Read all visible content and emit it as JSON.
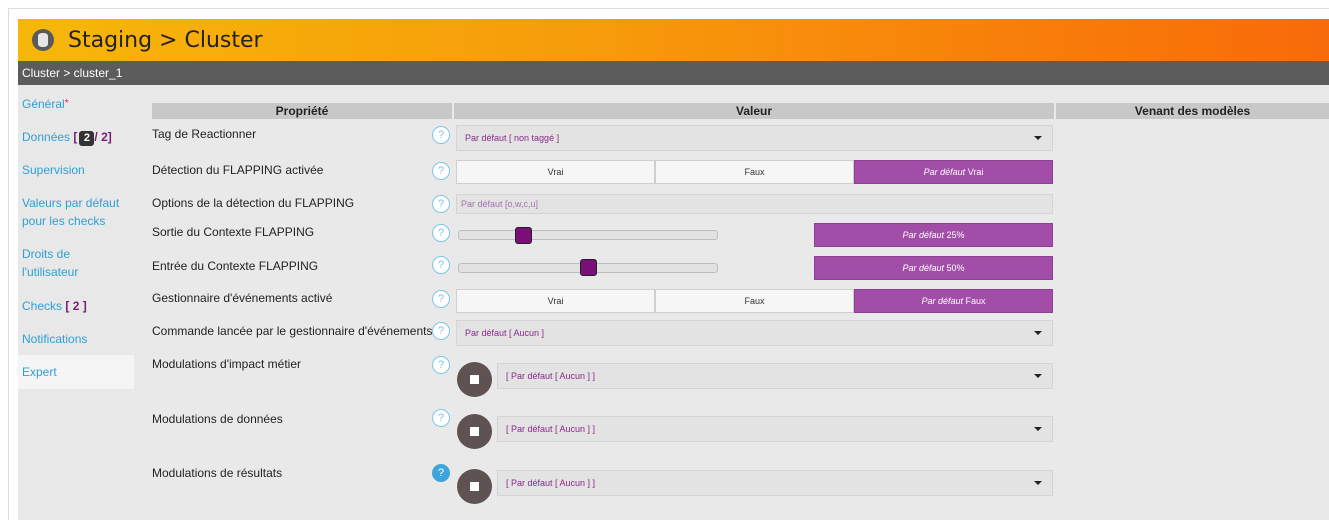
{
  "header": {
    "title": "Staging > Cluster",
    "icon": "database-icon"
  },
  "breadcrumb": "Cluster > cluster_1",
  "sidebar": {
    "general": {
      "label": "Général",
      "required_mark": "*"
    },
    "donnees": {
      "label": "Données",
      "open": "[",
      "badge": "2",
      "sep": "/",
      "count": "2",
      "close": "]"
    },
    "supervision": "Supervision",
    "valeurs": "Valeurs par défaut pour les checks",
    "droits": "Droits de l'utilisateur",
    "checks": {
      "label": "Checks",
      "count": "[ 2 ]"
    },
    "notifications": "Notifications",
    "expert": "Expert"
  },
  "table": {
    "headers": [
      "Propriété",
      "Valeur",
      "Venant des modèles"
    ]
  },
  "help_glyph": "?",
  "props": {
    "tag": {
      "label": "Tag de Reactionner",
      "value": "Par défaut [ non taggé ]"
    },
    "flapping": {
      "label": "Détection du FLAPPING activée",
      "options": [
        "Vrai",
        "Faux"
      ],
      "default_prefix": "Par défaut",
      "default_value": "Vrai"
    },
    "flap_opts": {
      "label": "Options de la détection du FLAPPING",
      "placeholder": "Par défaut [o,w,c,u]"
    },
    "sortie": {
      "label": "Sortie du Contexte FLAPPING",
      "default_prefix": "Par défaut",
      "default_value": "25%",
      "level": 0.25
    },
    "entree": {
      "label": "Entrée du Contexte FLAPPING",
      "default_prefix": "Par défaut",
      "default_value": "50%",
      "level": 0.5
    },
    "gest": {
      "label": "Gestionnaire d'événements activé",
      "options": [
        "Vrai",
        "Faux"
      ],
      "default_prefix": "Par défaut",
      "default_value": "Faux"
    },
    "commande": {
      "label": "Commande lancée par le gestionnaire d'événements",
      "value": "Par défaut [ Aucun ]"
    },
    "mod_impact": {
      "label": "Modulations d'impact métier",
      "value": "[ Par défaut [ Aucun ] ]"
    },
    "mod_donnees": {
      "label": "Modulations de données",
      "value": "[ Par défaut [ Aucun ] ]"
    },
    "mod_resultats": {
      "label": "Modulations de résultats",
      "value": "[ Par défaut [ Aucun ] ]"
    }
  },
  "colors": {
    "accent": "#a24ea8",
    "link": "#2f9fd5",
    "header_start": "#f7b70a",
    "header_end": "#f96a0a"
  }
}
